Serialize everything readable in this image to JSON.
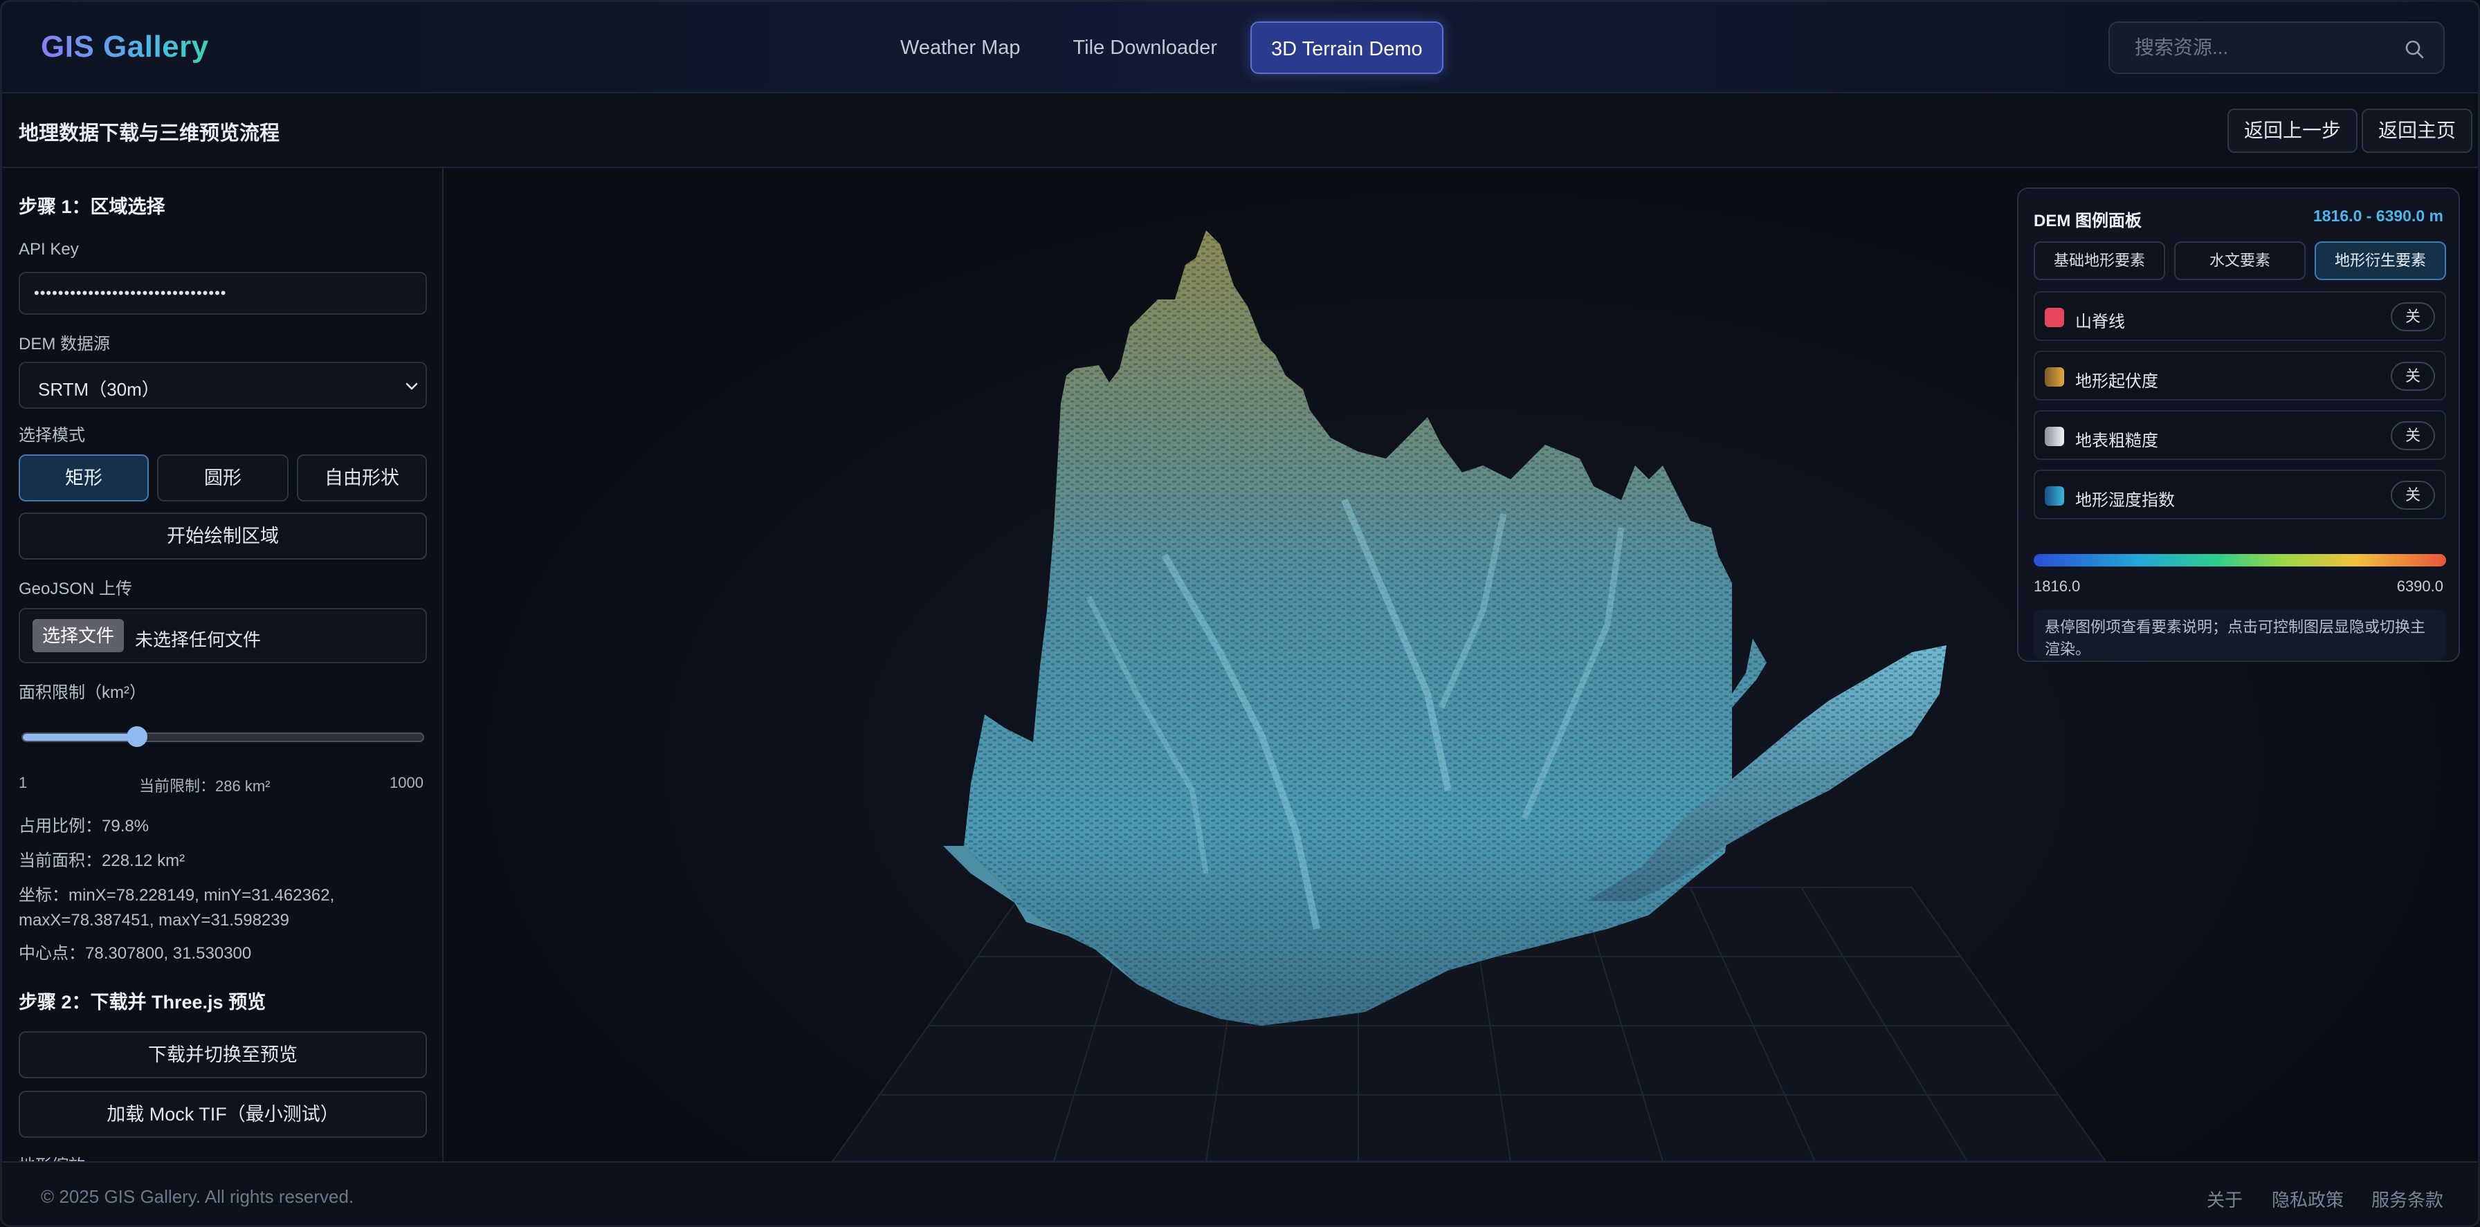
{
  "app": {
    "brand": "GIS Gallery"
  },
  "nav": {
    "links": [
      {
        "label": "Weather Map"
      },
      {
        "label": "Tile Downloader"
      },
      {
        "label": "3D Terrain Demo"
      }
    ],
    "active_index": 2
  },
  "search": {
    "placeholder": "搜索资源..."
  },
  "header": {
    "title": "地理数据下载与三维预览流程",
    "back_step_label": "返回上一步",
    "home_label": "返回主页"
  },
  "step1": {
    "heading": "步骤 1：区域选择",
    "api_key_label": "API Key",
    "api_key_value": "••••••••••••••••••••••••••••••••",
    "dem_source_label": "DEM 数据源",
    "dem_source_value": "SRTM（30m）",
    "mode_label": "选择模式",
    "modes": [
      "矩形",
      "圆形",
      "自由形状"
    ],
    "selected_mode": "矩形",
    "start_draw_label": "开始绘制区域",
    "geojson_label": "GeoJSON 上传",
    "choose_file_label": "选择文件",
    "no_file_label": "未选择任何文件",
    "area_limit_label": "面积限制（km²）",
    "slider_min": "1",
    "slider_max": "1000",
    "slider_value_fraction": 0.286,
    "current_limit_text": "当前限制：286 km²",
    "usage_ratio": "占用比例：79.8%",
    "current_area": "当前面积：228.12 km²",
    "coords_line1": "坐标：minX=78.228149, minY=31.462362,",
    "coords_line2": "maxX=78.387451, maxY=31.598239",
    "center": "中心点：78.307800, 31.530300"
  },
  "step2": {
    "heading": "步骤 2：下载并 Three.js 预览",
    "download_label": "下载并切换至预览",
    "mock_label": "加载 Mock TIF（最小测试）",
    "cut_label": "地形缩放"
  },
  "legend": {
    "title": "DEM 图例面板",
    "range": "1816.0 - 6390.0 m",
    "tabs": [
      "基础地形要素",
      "水文要素",
      "地形衍生要素"
    ],
    "selected_tab": "地形衍生要素",
    "items": [
      {
        "name": "山脊线",
        "toggle": "关",
        "color": "#e8455c"
      },
      {
        "name": "地形起伏度",
        "toggle": "关",
        "color": "#c9973a"
      },
      {
        "name": "地表粗糙度",
        "toggle": "关",
        "color": "#c4c8d2"
      },
      {
        "name": "地形湿度指数",
        "toggle": "关",
        "color": "#2a8fc4"
      }
    ],
    "min": "1816.0",
    "max": "6390.0",
    "help": "悬停图例项查看要素说明；点击可控制图层显隐或切换主渲染。"
  },
  "footer": {
    "copyright": "© 2025 GIS Gallery. All rights reserved.",
    "links": [
      "关于",
      "隐私政策",
      "服务条款"
    ]
  }
}
